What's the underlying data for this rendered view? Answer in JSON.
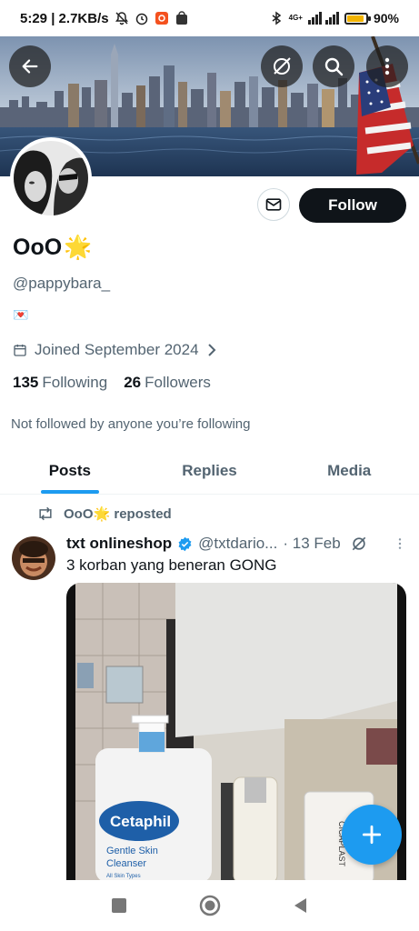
{
  "status_bar": {
    "time_speed": "5:29 | 2.7KB/s",
    "network": "4G+",
    "battery": "90%",
    "battery_level": 0.9
  },
  "profile": {
    "display_name": "OoO",
    "name_emoji": "🌟",
    "handle": "@pappybara_",
    "bio": "💌",
    "joined": "Joined September 2024",
    "following_count": "135",
    "following_label": "Following",
    "followers_count": "26",
    "followers_label": "Followers",
    "not_followed_note": "Not followed by anyone you’re following",
    "follow_label": "Follow"
  },
  "tabs": [
    {
      "label": "Posts",
      "active": true
    },
    {
      "label": "Replies",
      "active": false
    },
    {
      "label": "Media",
      "active": false
    }
  ],
  "post": {
    "repost_name": "OoO",
    "repost_emoji": "🌟",
    "repost_label": "reposted",
    "author_name": "txt onlineshop",
    "author_handle": "@txtdario...",
    "date": "· 13 Feb",
    "text": "3 korban yang beneran GONG",
    "media_brand": "Cetaphil",
    "media_product_line1": "Gentle Skin",
    "media_product_line2": "Cleanser",
    "media_sub": "All Skin Types",
    "media_brand2": "CICAPLAST"
  },
  "colors": {
    "accent": "#1d9bf0",
    "text": "#0f1419",
    "muted": "#536471",
    "follow_bg": "#0f1419"
  },
  "icons": [
    "back-arrow-icon",
    "grok-icon",
    "search-icon",
    "more-vertical-icon",
    "mail-icon",
    "calendar-icon",
    "chevron-right-icon",
    "repost-icon",
    "verified-icon",
    "plus-icon"
  ]
}
